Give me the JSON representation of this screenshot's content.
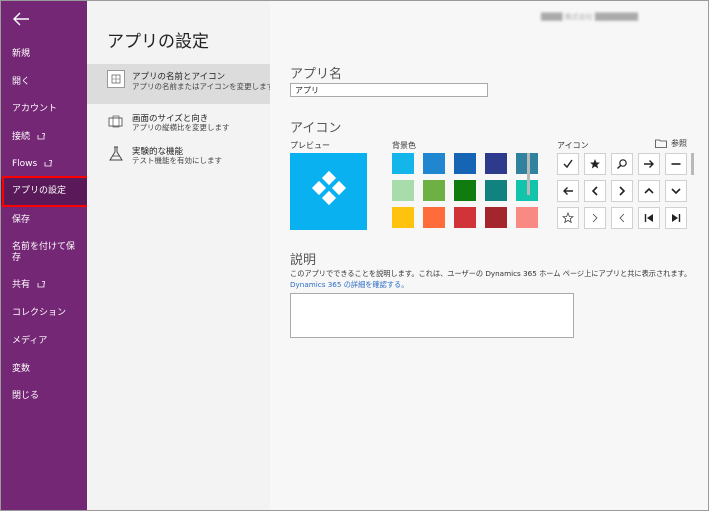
{
  "sidebar": {
    "items": [
      {
        "label": "新規",
        "external": false
      },
      {
        "label": "開く",
        "external": false
      },
      {
        "label": "アカウント",
        "external": false
      },
      {
        "label": "接続",
        "external": true
      },
      {
        "label": "Flows",
        "external": true
      },
      {
        "label": "アプリの設定",
        "external": false,
        "active": true
      },
      {
        "label": "保存",
        "external": false
      },
      {
        "label": "名前を付けて保存",
        "external": false
      },
      {
        "label": "共有",
        "external": true
      },
      {
        "label": "コレクション",
        "external": false
      },
      {
        "label": "メディア",
        "external": false
      },
      {
        "label": "変数",
        "external": false
      },
      {
        "label": "閉じる",
        "external": false
      }
    ]
  },
  "header": {
    "page_title": "アプリの設定",
    "user_info": "████ 株式会社 ████████"
  },
  "subnav": {
    "items": [
      {
        "title": "アプリの名前とアイコン",
        "desc": "アプリの名前またはアイコンを変更します",
        "icon": "app-grid-icon"
      },
      {
        "title": "画面のサイズと向き",
        "desc": "アプリの縦横比を変更します",
        "icon": "screen-size-icon"
      },
      {
        "title": "実験的な機能",
        "desc": "テスト機能を有効にします",
        "icon": "flask-icon"
      }
    ]
  },
  "main": {
    "app_name_heading": "アプリ名",
    "app_name_value": "アプリ",
    "icon_heading": "アイコン",
    "preview_label": "プレビュー",
    "bg_color_label": "背景色",
    "icon_label": "アイコン",
    "browse_label": "参照",
    "description_heading": "説明",
    "description_text": "このアプリでできることを説明します。これは、ユーザーの Dynamics 365 ホーム ページ上にアプリと共に表示されます。",
    "description_link": "Dynamics 365 の詳細を確認する。",
    "description_value": ""
  },
  "colors": {
    "sidebar": "#742774",
    "preview_bg": "#0ab1f0",
    "swatches": [
      "#13b5ea",
      "#1f86cf",
      "#1665b5",
      "#2e3a8c",
      "#31829e",
      "#a8dcaa",
      "#6db043",
      "#107c10",
      "#128281",
      "#13c4ad",
      "#ffc20f",
      "#ff6c3c",
      "#d13438",
      "#a4262c",
      "#f98a83"
    ]
  },
  "icons": [
    "check-icon",
    "star-icon",
    "search-icon",
    "arrow-right-icon",
    "minus-icon",
    "arrow-left-icon",
    "chevron-left-icon",
    "chevron-right-icon",
    "chevron-up-icon",
    "chevron-down-icon",
    "star-outline-icon",
    "chevron-right-thin-icon",
    "chevron-left-thin-icon",
    "skip-back-icon",
    "skip-forward-icon"
  ]
}
